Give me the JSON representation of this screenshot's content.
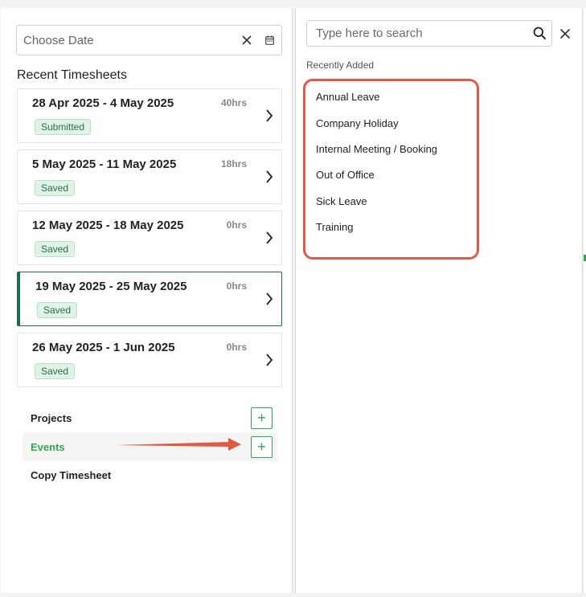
{
  "date_picker": {
    "placeholder": "Choose Date"
  },
  "recent_section": {
    "title": "Recent Timesheets"
  },
  "timesheets": [
    {
      "range": "28 Apr 2025 - 4 May 2025",
      "hours": "40hrs",
      "status": "Submitted"
    },
    {
      "range": "5 May 2025 - 11 May 2025",
      "hours": "18hrs",
      "status": "Saved"
    },
    {
      "range": "12 May 2025 - 18 May 2025",
      "hours": "0hrs",
      "status": "Saved"
    },
    {
      "range": "19 May 2025 - 25 May 2025",
      "hours": "0hrs",
      "status": "Saved",
      "selected": true
    },
    {
      "range": "26 May 2025 - 1 Jun 2025",
      "hours": "0hrs",
      "status": "Saved"
    }
  ],
  "actions": {
    "projects_label": "Projects",
    "events_label": "Events",
    "copy_label": "Copy Timesheet",
    "add_symbol": "+"
  },
  "event_panel": {
    "search_placeholder": "Type here to search",
    "recent_label": "Recently Added",
    "events": [
      "Annual Leave",
      "Company Holiday",
      "Internal Meeting / Booking",
      "Out of Office",
      "Sick Leave",
      "Training"
    ]
  },
  "colors": {
    "accent_green": "#2fa84f",
    "selected_border": "#1f6b52",
    "annotation_red": "#e05a44"
  },
  "icons": [
    "close-icon",
    "calendar-icon",
    "chevron-right-icon",
    "search-icon",
    "plus-icon"
  ]
}
